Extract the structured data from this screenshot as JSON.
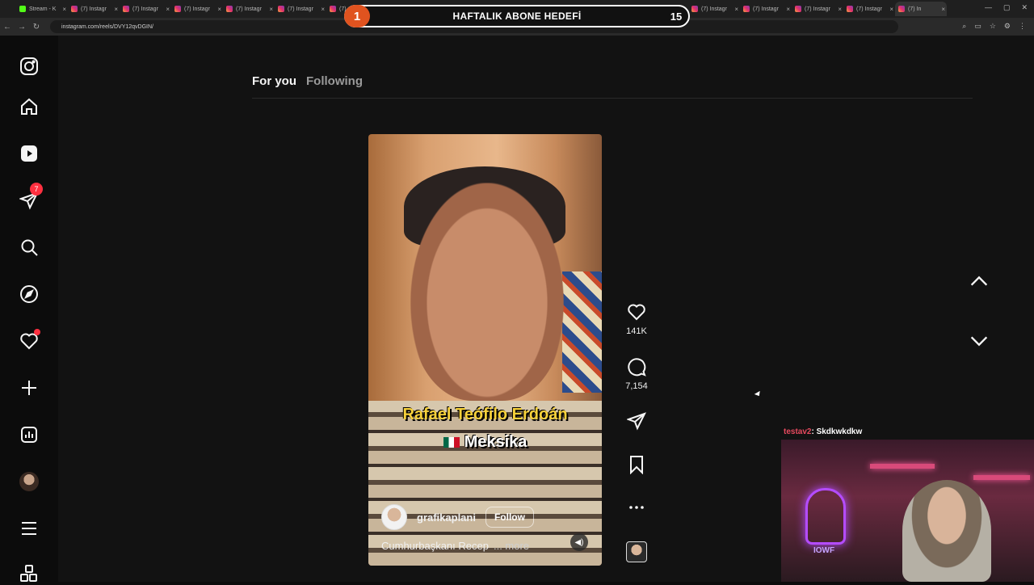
{
  "browser": {
    "tabs": [
      {
        "label": "Stream - K",
        "icon": "kick-icon",
        "active": false
      },
      {
        "label": "(7) Instagr",
        "icon": "instagram-icon",
        "active": false
      },
      {
        "label": "(7) Instagr",
        "icon": "instagram-icon",
        "active": false
      },
      {
        "label": "(7) Instagr",
        "icon": "instagram-icon",
        "active": false
      },
      {
        "label": "(7) Instagr",
        "icon": "instagram-icon",
        "active": false
      },
      {
        "label": "(7) Instagr",
        "icon": "instagram-icon",
        "active": false
      },
      {
        "label": "(7)",
        "icon": "instagram-icon",
        "active": false
      },
      {
        "label": "(7) Instagr",
        "icon": "instagram-icon",
        "active": false
      },
      {
        "label": "(7) Instagr",
        "icon": "instagram-icon",
        "active": false
      },
      {
        "label": "(7) Instagr",
        "icon": "instagram-icon",
        "active": false
      },
      {
        "label": "(7) Instagr",
        "icon": "instagram-icon",
        "active": false
      },
      {
        "label": "(7) Instagr",
        "icon": "instagram-icon",
        "active": false
      },
      {
        "label": "(7) Instagr",
        "icon": "instagram-icon",
        "active": false
      },
      {
        "label": "(7) Instagr",
        "icon": "instagram-icon",
        "active": false
      },
      {
        "label": "(7) Instagr",
        "icon": "instagram-icon",
        "active": false
      },
      {
        "label": "(7) Instagr",
        "icon": "instagram-icon",
        "active": false
      },
      {
        "label": "(7) Instagr",
        "icon": "instagram-icon",
        "active": false
      },
      {
        "label": "(7) In",
        "icon": "instagram-icon",
        "active": true
      }
    ],
    "url": "instagram.com/reels/DVY12qvDGIN/"
  },
  "overlay": {
    "goal_current": "1",
    "goal_title": "HAFTALIK ABONE HEDEFİ",
    "goal_target": "15"
  },
  "sidebar": {
    "notifications_badge": "7",
    "items": [
      "instagram-logo-icon",
      "home-icon",
      "reels-icon",
      "messages-icon",
      "search-icon",
      "explore-icon",
      "notifications-icon",
      "create-icon",
      "dashboard-icon",
      "profile-avatar",
      "menu-icon",
      "more-apps-icon"
    ]
  },
  "feed": {
    "tab_for_you": "For you",
    "tab_following": "Following"
  },
  "reel": {
    "caption_name": "Rafael Teófilo Erdoán",
    "caption_country": "Meksika",
    "username": "grafikaplani",
    "follow_label": "Follow",
    "description": "Cumhurbaşkanı Recep",
    "more_label": "... more"
  },
  "actions": {
    "likes": "141K",
    "comments": "7,154"
  },
  "webcam": {
    "chat_user": "testav2",
    "chat_message": ": Skdkwkdkw",
    "neon_text": "IOWF"
  },
  "colors": {
    "instagram_bg": "#121212",
    "badge_red": "#ff3040",
    "caption_yellow": "#f7d13a",
    "overlay_orange": "#e0531f"
  }
}
